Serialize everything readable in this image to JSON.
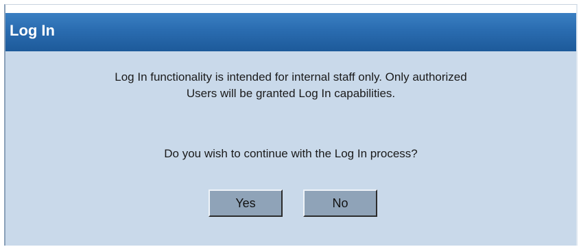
{
  "dialog": {
    "title": "Log In",
    "message_line1": "Log In functionality is intended for internal staff only. Only authorized",
    "message_line2": "Users will be granted Log In capabilities.",
    "question": "Do you wish to continue with the Log In process?",
    "yes_label": "Yes",
    "no_label": "No"
  },
  "colors": {
    "titlebar": "#2a6cb0",
    "body_background": "#c9d9ea",
    "button_background": "#8fa3b8"
  }
}
